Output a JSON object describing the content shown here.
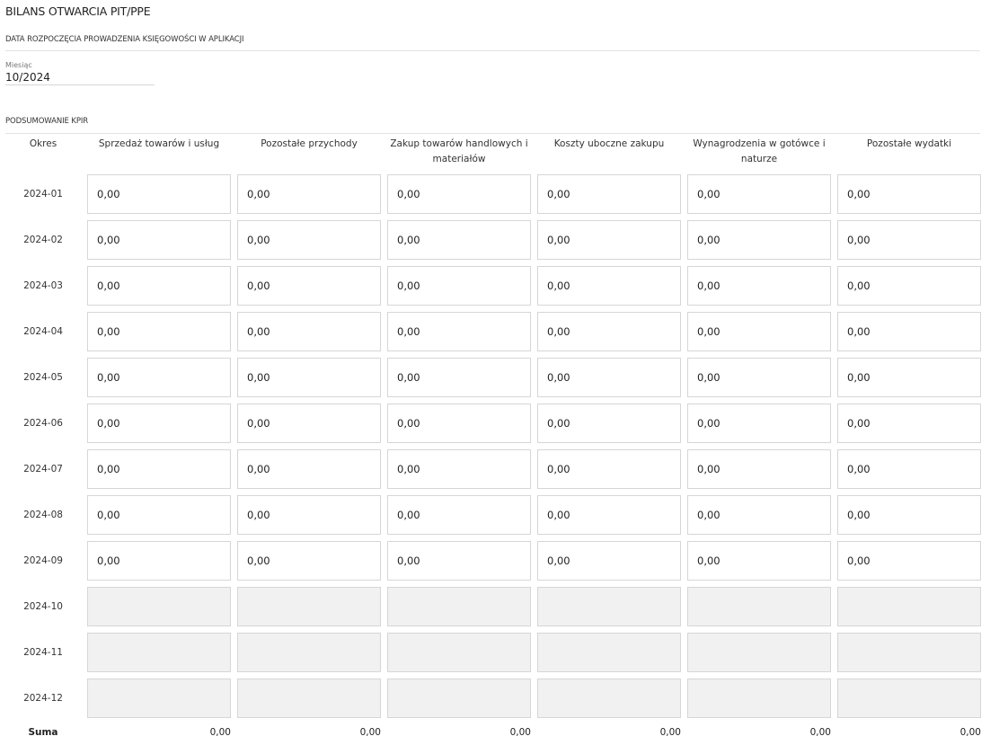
{
  "page": {
    "title": "BILANS OTWARCIA PIT/PPE"
  },
  "start_section": {
    "heading": "DATA ROZPOCZĘCIA PROWADZENIA KSIĘGOWOŚCI W APLIKACJI",
    "month_label": "Miesiąc",
    "month_value": "10/2024"
  },
  "kpir_section": {
    "heading": "PODSUMOWANIE KPIR",
    "columns": [
      "Okres",
      "Sprzedaż towarów i usług",
      "Pozostałe przychody",
      "Zakup towarów handlowych i materiałów",
      "Koszty uboczne zakupu",
      "Wynagrodzenia w gotówce i naturze",
      "Pozostałe wydatki"
    ],
    "rows": [
      {
        "period": "2024-01",
        "values": [
          "0,00",
          "0,00",
          "0,00",
          "0,00",
          "0,00",
          "0,00"
        ],
        "enabled": true
      },
      {
        "period": "2024-02",
        "values": [
          "0,00",
          "0,00",
          "0,00",
          "0,00",
          "0,00",
          "0,00"
        ],
        "enabled": true
      },
      {
        "period": "2024-03",
        "values": [
          "0,00",
          "0,00",
          "0,00",
          "0,00",
          "0,00",
          "0,00"
        ],
        "enabled": true
      },
      {
        "period": "2024-04",
        "values": [
          "0,00",
          "0,00",
          "0,00",
          "0,00",
          "0,00",
          "0,00"
        ],
        "enabled": true
      },
      {
        "period": "2024-05",
        "values": [
          "0,00",
          "0,00",
          "0,00",
          "0,00",
          "0,00",
          "0,00"
        ],
        "enabled": true
      },
      {
        "period": "2024-06",
        "values": [
          "0,00",
          "0,00",
          "0,00",
          "0,00",
          "0,00",
          "0,00"
        ],
        "enabled": true
      },
      {
        "period": "2024-07",
        "values": [
          "0,00",
          "0,00",
          "0,00",
          "0,00",
          "0,00",
          "0,00"
        ],
        "enabled": true
      },
      {
        "period": "2024-08",
        "values": [
          "0,00",
          "0,00",
          "0,00",
          "0,00",
          "0,00",
          "0,00"
        ],
        "enabled": true
      },
      {
        "period": "2024-09",
        "values": [
          "0,00",
          "0,00",
          "0,00",
          "0,00",
          "0,00",
          "0,00"
        ],
        "enabled": true
      },
      {
        "period": "2024-10",
        "values": [
          "",
          "",
          "",
          "",
          "",
          ""
        ],
        "enabled": false
      },
      {
        "period": "2024-11",
        "values": [
          "",
          "",
          "",
          "",
          "",
          ""
        ],
        "enabled": false
      },
      {
        "period": "2024-12",
        "values": [
          "",
          "",
          "",
          "",
          "",
          ""
        ],
        "enabled": false
      }
    ],
    "sum_label": "Suma",
    "sums": [
      "0,00",
      "0,00",
      "0,00",
      "0,00",
      "0,00",
      "0,00"
    ]
  }
}
